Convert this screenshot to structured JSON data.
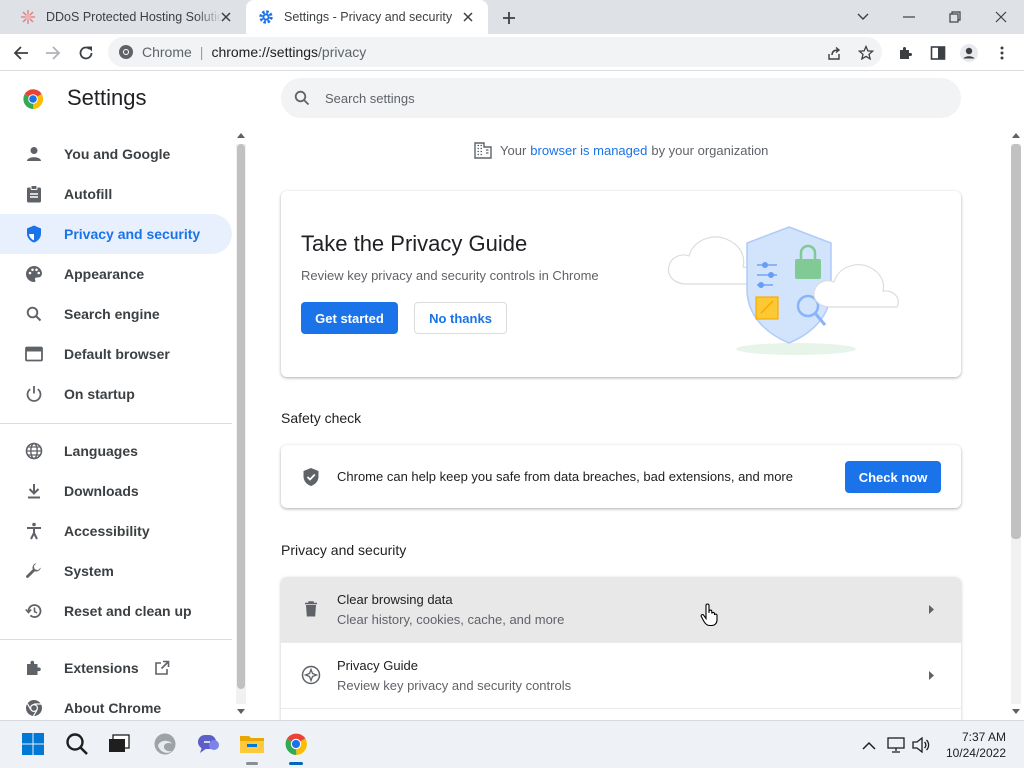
{
  "browser": {
    "tabs": [
      {
        "title": "DDoS Protected Hosting Solutions",
        "favicon": "spark-favicon-icon",
        "active": false
      },
      {
        "title": "Settings - Privacy and security",
        "favicon": "gear-icon",
        "active": true
      }
    ],
    "omnibox": {
      "site_label": "Chrome",
      "url_host": "chrome://settings",
      "url_path": "/privacy"
    }
  },
  "settings": {
    "title": "Settings",
    "search_placeholder": "Search settings",
    "sidebar": {
      "items": [
        {
          "label": "You and Google",
          "icon": "person-icon"
        },
        {
          "label": "Autofill",
          "icon": "clipboard-icon"
        },
        {
          "label": "Privacy and security",
          "icon": "shield-icon",
          "active": true
        },
        {
          "label": "Appearance",
          "icon": "palette-icon"
        },
        {
          "label": "Search engine",
          "icon": "search-icon"
        },
        {
          "label": "Default browser",
          "icon": "browser-window-icon"
        },
        {
          "label": "On startup",
          "icon": "power-icon"
        },
        {
          "label": "Languages",
          "icon": "globe-icon"
        },
        {
          "label": "Downloads",
          "icon": "download-icon"
        },
        {
          "label": "Accessibility",
          "icon": "accessibility-icon"
        },
        {
          "label": "System",
          "icon": "wrench-icon"
        },
        {
          "label": "Reset and clean up",
          "icon": "restore-icon"
        },
        {
          "label": "Extensions",
          "icon": "puzzle-icon"
        },
        {
          "label": "About Chrome",
          "icon": "chrome-icon"
        }
      ]
    },
    "managed": {
      "prefix": "Your",
      "link": "browser is managed",
      "suffix": "by your organization"
    },
    "privacy_guide": {
      "title": "Take the Privacy Guide",
      "description": "Review key privacy and security controls in Chrome",
      "start_label": "Get started",
      "dismiss_label": "No thanks"
    },
    "safety_check": {
      "heading": "Safety check",
      "text": "Chrome can help keep you safe from data breaches, bad extensions, and more",
      "button_label": "Check now"
    },
    "privacy_section": {
      "heading": "Privacy and security",
      "rows": [
        {
          "title": "Clear browsing data",
          "subtitle": "Clear history, cookies, cache, and more",
          "icon": "trash-icon"
        },
        {
          "title": "Privacy Guide",
          "subtitle": "Review key privacy and security controls",
          "icon": "compass-icon"
        }
      ]
    }
  },
  "taskbar": {
    "apps": [
      "windows-start-icon",
      "search-icon",
      "task-view-icon",
      "edge-icon",
      "teams-chat-icon",
      "file-explorer-icon",
      "chrome-icon"
    ],
    "time": "7:37 AM",
    "date": "10/24/2022"
  },
  "colors": {
    "accent": "#1a73e8",
    "active_nav_bg": "#e8f0fe",
    "tabstrip_bg": "#dee1e6"
  }
}
